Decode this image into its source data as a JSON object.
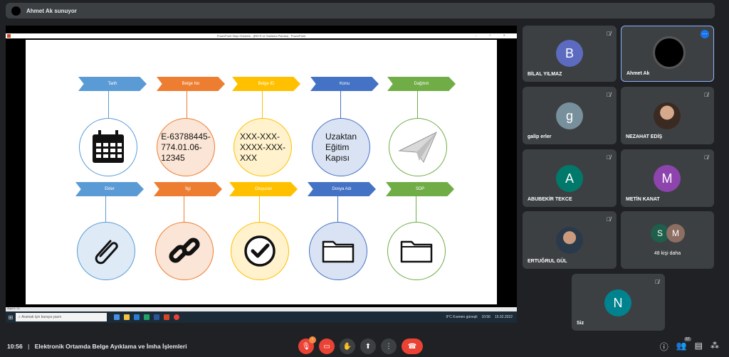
{
  "presenter": {
    "label": "Ahmet Ak sunuyor"
  },
  "ppt": {
    "window_title": "PowerPoint Slayt Gösterisi - [EBYS ve Saklama Planları] - PowerPoint",
    "status_left": "Slayt 6 / 24",
    "slide": {
      "top_row": [
        {
          "label": "Tarih",
          "color": "#5b9bd5",
          "content_type": "icon",
          "icon": "calendar-icon"
        },
        {
          "label": "Belge No",
          "color": "#ed7d31",
          "content_type": "text",
          "text": "E-63788445-\n774.01.06-\n12345"
        },
        {
          "label": "Belge ID",
          "color": "#ffc000",
          "content_type": "text",
          "text": "XXX-XXX-\nXXXX-XXX-\nXXX"
        },
        {
          "label": "Konu",
          "color": "#4472c4",
          "content_type": "text",
          "text": "Uzaktan\nEğitim\nKapısı"
        },
        {
          "label": "Dağıtım",
          "color": "#70ad47",
          "content_type": "icon",
          "icon": "paper-plane-icon"
        }
      ],
      "bottom_row": [
        {
          "label": "Ekler",
          "color": "#5b9bd5",
          "icon": "paperclip-icon"
        },
        {
          "label": "İlgi",
          "color": "#ed7d31",
          "icon": "link-icon"
        },
        {
          "label": "Oluşuran",
          "color": "#ffc000",
          "icon": "checkmark-icon"
        },
        {
          "label": "Dosya Adı",
          "color": "#4472c4",
          "icon": "folder-icon"
        },
        {
          "label": "SDP",
          "color": "#70ad47",
          "icon": "folder-icon"
        }
      ]
    },
    "taskbar": {
      "search_placeholder": "Aramak için buraya yazın",
      "weather": "9°C  Kısmen güneşli",
      "time": "10:56",
      "date": "15.02.2022"
    }
  },
  "participants": [
    {
      "name": "BİLAL YILMAZ",
      "initial": "B",
      "avatar_color": "#5c6bc0",
      "muted": true
    },
    {
      "name": "Ahmet Ak",
      "initial": "",
      "avatar_color": "#000000",
      "muted": false,
      "presenting": true
    },
    {
      "name": "galip erler",
      "initial": "g",
      "avatar_color": "#78909c",
      "muted": true
    },
    {
      "name": "NEZAHAT EDİŞ",
      "initial": "",
      "photo": true,
      "muted": true
    },
    {
      "name": "ABUBEKİR TEKCE",
      "initial": "A",
      "avatar_color": "#00796b",
      "muted": true
    },
    {
      "name": "METİN KANAT",
      "initial": "M",
      "avatar_color": "#8e44ad",
      "muted": true
    },
    {
      "name": "ERTUĞRUL GÜL",
      "initial": "",
      "photo": true,
      "muted": true
    },
    {
      "name": "48 kişi daha",
      "initials": [
        "S",
        "M"
      ],
      "colors": [
        "#1e5e4b",
        "#8d6e63"
      ]
    },
    {
      "name": "Siz",
      "initial": "N",
      "avatar_color": "#00838f",
      "muted": true
    }
  ],
  "bottom_bar": {
    "time": "10:56",
    "separator": "|",
    "meeting_title": "Elektronik Ortamda Belge Ayıklama ve İmha İşlemleri",
    "participants_count": "57"
  }
}
